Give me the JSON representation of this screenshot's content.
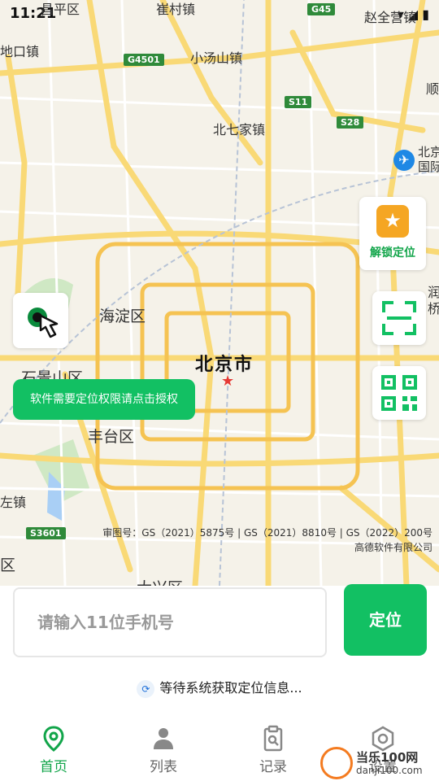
{
  "status_bar": {
    "time": "11:21",
    "icons": "▾ ◢ ▮"
  },
  "map": {
    "labels": {
      "changping": "昌平区",
      "cuicun": "崔村镇",
      "zhaoquanying": "赵全营镇",
      "shankou": "地口镇",
      "xiaotangshan": "小汤山镇",
      "beiqijia": "北七家镇",
      "shun": "顺",
      "beijing_airport": "北京\n国际",
      "haidian": "海淀区",
      "beijing_city": "北京市",
      "shijingshan": "石景山区",
      "fengtai": "丰台区",
      "zuo": "左镇",
      "qu": "区",
      "daxing": "大兴区",
      "run": "润\n桥"
    },
    "road_tags": {
      "g45": "G45",
      "g4501": "G4501",
      "s11": "S11",
      "s28": "S28",
      "s3601": "S3601"
    },
    "copyright_line1": "审图号：GS（2021）5875号 | GS（2021）8810号 | GS（2022）200号",
    "copyright_line2": "高德软件有限公司"
  },
  "side_buttons": {
    "unlock_label": "解锁定位",
    "unlock_icon": "star-badge-icon",
    "scan_icon": "scan-icon",
    "qr_icon": "qr-code-icon",
    "locate_me_icon": "tap-location-icon"
  },
  "permission_tip": "软件需要定位权限请点击授权",
  "search": {
    "placeholder": "请输入11位手机号",
    "locate_label": "定位"
  },
  "waiting_text": "等待系统获取定位信息...",
  "tabs": [
    {
      "label": "首页",
      "icon": "location-pin-icon",
      "active": true
    },
    {
      "label": "列表",
      "icon": "users-icon",
      "active": false
    },
    {
      "label": "记录",
      "icon": "clipboard-icon",
      "active": false
    },
    {
      "label": "设置",
      "icon": "settings-icon",
      "active": false
    }
  ],
  "watermark": {
    "title": "当乐100网",
    "sub": "danji100.com"
  },
  "colors": {
    "accent": "#12c063",
    "accent_text": "#12a54a",
    "road_major": "#f9d976",
    "road_ring": "#f5c352",
    "unlock_badge": "#f5a623"
  }
}
